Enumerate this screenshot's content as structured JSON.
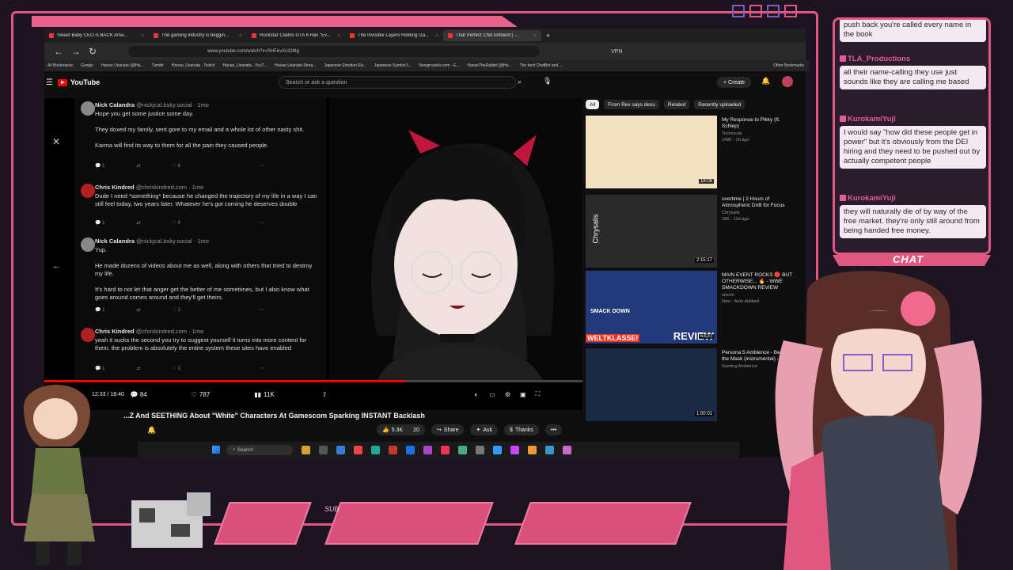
{
  "browser": {
    "tabs": [
      {
        "label": "Sweet Baby CEO is BACK Ama...",
        "active": false
      },
      {
        "label": "The gaming industry is beggin...",
        "active": false
      },
      {
        "label": "Rockstar Claims GTA 6 Has \"Ev...",
        "active": false
      },
      {
        "label": "The Invisible Layers Holding Ga...",
        "active": false
      },
      {
        "label": "That Perfect Chill Ambient | ...",
        "active": true
      }
    ],
    "new_tab": "+",
    "url": "www.youtube.com/watch?v=SHFevXcIOMg",
    "vpn": "VPN",
    "bookmarks": [
      "All Bookmarks",
      "Google",
      "Hanao Usanata (@Ha...",
      "Tumblr",
      "Hanao_Usanata - Twitch",
      "Hanao_Usanata - YouT...",
      "Hanao Usanata Strea...",
      "Japanese Emotion Ra...",
      "Japanese Symbol f...",
      "Newgrounds.com - E...",
      "HanasTheRabbit (@Ha...",
      "The best ChatBot and ...",
      "Other Bookmarks"
    ]
  },
  "youtube": {
    "logo_text": "YouTube",
    "search_placeholder": "Search or ask a question",
    "create_label": "Create",
    "video_title": "...Z And SEETHING About \"White\" Characters At Gamescom Sparking INSTANT Backlash",
    "time": "12:33 / 18:40",
    "stats": {
      "comments": "84",
      "likes": "787",
      "views": "11K"
    },
    "progress_fraction": 0.67,
    "actions": {
      "likes": "5.3K",
      "dislikes": "20",
      "share": "Share",
      "ask": "Ask",
      "thanks": "Thanks",
      "more": "•••"
    }
  },
  "comments": [
    {
      "name": "Nick Calandra",
      "handle": "@nickjcal.bsky.social · 1mo",
      "text": "Hope you get some justice some day.\n\nThey doxed my family, sent gore to my email and a whole lot of other nasty shit.\n\nKarma will find its way to them for all the pain they caused people.",
      "reply": "1",
      "like": "6",
      "avatar": "#888888"
    },
    {
      "name": "Chris Kindred",
      "handle": "@chriskindred.com · 1mo",
      "text": "Dude I need *something* because he changed the trajectory of my life in a way I can still feel today, two years later. Whatever he's got coming he deserves double",
      "reply": "1",
      "like": "4",
      "avatar": "#b02020"
    },
    {
      "name": "Nick Calandra",
      "handle": "@nickjcal.bsky.social · 1mo",
      "text": "Yup.\n\nHe made dozens of videos about me as well, along with others that tried to destroy my life.\n\nIt's hard to not let that anger get the better of me sometimes, but I also know what goes around comes around and they'll get theirs.",
      "reply": "1",
      "like": "2",
      "avatar": "#888888"
    },
    {
      "name": "Chris Kindred",
      "handle": "@chriskindred.com · 1mo",
      "text": "yeah it sucks the second you try to suggest yourself it turns into more content for them. the problem is absolutely the entire system these sites have enabled",
      "reply": "1",
      "like": "3",
      "avatar": "#b02020"
    }
  ],
  "sidebar": {
    "chips": [
      "All",
      "From Rev says desu",
      "Related",
      "Recently uploaded"
    ],
    "videos": [
      {
        "title": "My Response to Pikky (ft. Schlep)",
        "channel": "Technicals",
        "stats": "149K · 2d ago",
        "duration": "18:08",
        "color": "#f2e2c2"
      },
      {
        "title": "overtime | 2 Hours of Atmospheric DnB for Focus",
        "channel": "Chrysalis",
        "stats": "16K · 12d ago",
        "duration": "2:15:17",
        "color": "#2a2a2a"
      },
      {
        "title": "MAIN EVENT ROCKS 🔴 BUT OTHERWISE... 🔥 - WWE SMACKDOWN REVIEW",
        "channel": "sivoon",
        "stats": "New · Auto-dubbed",
        "duration": "53:27",
        "color": "#223a7a"
      },
      {
        "title": "Persona 5 Ambience - Beneath the Mask (instrumental) - 1...",
        "channel": "Gaming Ambience",
        "stats": "",
        "duration": "1:00:01",
        "color": "#1b2a44"
      }
    ],
    "chrysalis_label": "Chrysalis",
    "weltklasse": "WELTKLASSE!",
    "review": "REVIEW",
    "smack": "SMACK DOWN"
  },
  "taskbar": {
    "search": "Search"
  },
  "chat": {
    "label": "CHAT",
    "messages": [
      {
        "user": "",
        "text": "push back you're called every name in the book"
      },
      {
        "user": "TLA_Productions",
        "text": "all their name-calling they use just sounds like they are calling me based"
      },
      {
        "user": "KurokamiYuji",
        "text": "I would say \"how did these people get in power\" but it's obviously from the DEI hiring and they need to be pushed out by actually competent people"
      },
      {
        "user": "KurokamiYuji",
        "text": "they will naturally die of by way of the free market. they're only still around from being handed free money."
      }
    ]
  },
  "overlay": {
    "sub_label": "SUB"
  },
  "colors": {
    "accent": "#e0587f",
    "accent2": "#7560c0",
    "yt_red": "#ff0000"
  }
}
